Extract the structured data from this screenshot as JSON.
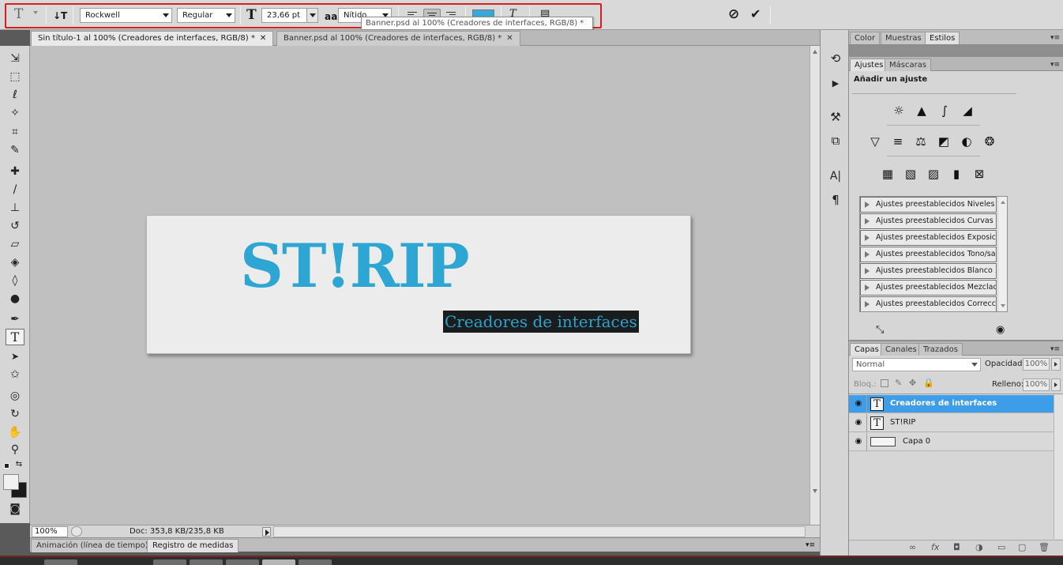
{
  "options_bar": {
    "tool_glyph": "T",
    "orient_glyph": "↓T",
    "font_family": "Rockwell",
    "font_style": "Regular",
    "size_glyph": "T",
    "font_size": "23,66 pt",
    "aa_glyph": "a a",
    "antialias": "Nítido",
    "color_swatch": "#3aa7d6",
    "warp_glyph": "T",
    "panels_glyph": "▤",
    "cancel_glyph": "⊘",
    "commit_glyph": "✔",
    "tooltip": "Banner.psd al 100% (Creadores de interfaces, RGB/8) *",
    "highlight_color": "#d61f1f"
  },
  "doc_tabs": [
    {
      "label": "Sin título-1 al 100% (Creadores de interfaces, RGB/8) *",
      "close": "✕"
    },
    {
      "label": "Banner.psd al 100% (Creadores de interfaces, RGB/8) *",
      "close": "✕"
    }
  ],
  "tools": {
    "move": "⇲",
    "marquee": "⬚",
    "lasso": "ℓ",
    "wand": "✧",
    "crop": "⌗",
    "eyedropper": "✎",
    "healing": "✚",
    "brush": "/",
    "stamp": "⊥",
    "history_brush": "↺",
    "eraser": "▱",
    "bucket": "◈",
    "blur": "◊",
    "dodge": "●",
    "pen": "✒",
    "type": "T",
    "path_select": "➤",
    "shape": "✩",
    "3d_rotate": "◎",
    "3d_orbit": "↻",
    "hand": "✋",
    "zoom": "⚲",
    "swap": "⇆",
    "quick_mask": "◙"
  },
  "document": {
    "headline": "ST!RIP",
    "subtitle": "Creadores de interfaces",
    "text_color": "#2ea6d4",
    "selection_bg": "#1a1d1e"
  },
  "status": {
    "zoom": "100%",
    "doc_info": "Doc: 353,8 KB/235,8 KB"
  },
  "bottom_tabs": [
    {
      "label": "Animación (línea de tiempo)"
    },
    {
      "label": "Registro de medidas"
    }
  ],
  "dock": {
    "history": "⟲",
    "actions": "▶",
    "tool_presets": "⚒",
    "clone_source": "⧉",
    "character": "A|",
    "paragraph": "¶"
  },
  "top_panel_tabs": [
    {
      "label": "Color"
    },
    {
      "label": "Muestras"
    },
    {
      "label": "Estilos"
    }
  ],
  "adjust_tabs": [
    {
      "label": "Ajustes"
    },
    {
      "label": "Máscaras"
    }
  ],
  "adjustments": {
    "title": "Añadir un ajuste",
    "row1": [
      "☼",
      "▲",
      "∫",
      "◢"
    ],
    "row2": [
      "▽",
      "≡",
      "⚖",
      "◩",
      "◐",
      "❂"
    ],
    "row3": [
      "▦",
      "▧",
      "▨",
      "▮",
      "⊠"
    ],
    "presets": [
      "Ajustes preestablecidos Niveles",
      "Ajustes preestablecidos Curvas",
      "Ajustes preestablecidos Exposici...",
      "Ajustes preestablecidos Tono/sa...",
      "Ajustes preestablecidos Blanco ...",
      "Ajustes preestablecidos Mezclad...",
      "Ajustes preestablecidos Correcci..."
    ],
    "footer_left": "⤡",
    "footer_right": "◉"
  },
  "layers_tabs": [
    {
      "label": "Capas"
    },
    {
      "label": "Canales"
    },
    {
      "label": "Trazados"
    }
  ],
  "layers": {
    "blend_mode": "Normal",
    "opacity_label": "Opacidad:",
    "opacity": "100%",
    "lock_label": "Bloq.:",
    "fill_label": "Relleno:",
    "fill": "100%",
    "items": [
      {
        "name": "Creadores de interfaces",
        "thumb": "T",
        "eye": "◉"
      },
      {
        "name": "ST!RIP",
        "thumb": "T",
        "eye": "◉"
      },
      {
        "name": "Capa 0",
        "eye": "◉"
      }
    ],
    "footer_icons": [
      "∞",
      "fx",
      "◘",
      "◑",
      "▭",
      "▢",
      "🗑"
    ]
  },
  "accent_color": "#3e9de8"
}
